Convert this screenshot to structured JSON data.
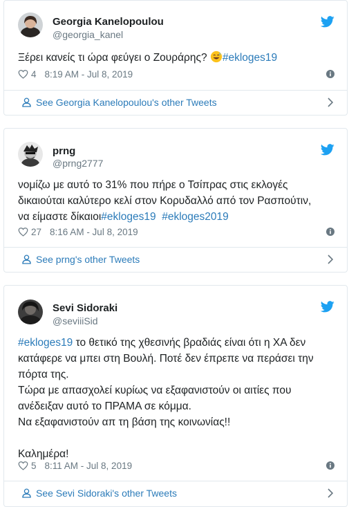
{
  "tweets": [
    {
      "name": "Georgia Kanelopoulou",
      "handle": "@georgia_kanel",
      "text_before": "Ξέρει κανείς τι ώρα φεύγει ο Ζουράρης? ",
      "emoji": "grinning-sweat-emoji",
      "text_hashtag": "#ekloges19",
      "likes": "4",
      "timestamp": "8:19 AM - Jul 8, 2019",
      "other_link": "See Georgia Kanelopoulou's other Tweets"
    },
    {
      "name": "prng",
      "handle": "@prng2777",
      "line1": "νομίζω με αυτό το 31% που πήρε ο Τσίπρας στις εκλογές",
      "line2": "δικαιούται καλύτερο κελί στον Κορυδαλλό από τον Ρασπούτιν,",
      "line3_text": "να είμαστε δίκαιοι",
      "hashtag1": "#ekloges19",
      "hashtag2": "#ekloges2019",
      "likes": "27",
      "timestamp": "8:16 AM - Jul 8, 2019",
      "other_link": "See prng's other Tweets"
    },
    {
      "name": "Sevi Sidoraki",
      "handle": "@seviiiSid",
      "hashtag": "#ekloges19",
      "line1_rest": " το θετικό της χθεσινής βραδιάς είναι ότι η ΧΑ δεν",
      "line2": "κατάφερε να μπει στη Βουλή. Ποτέ δεν έπρεπε να περάσει την",
      "line3": "πόρτα της.",
      "line4": "Τώρα με απασχολεί κυρίως να εξαφανιστούν οι αιτίες που",
      "line5": "ανέδειξαν αυτό το ΠΡΑΜΑ σε κόμμα.",
      "line6": "Να εξαφανιστούν απ τη βάση της κοινωνίας!!",
      "line7": "Καλημέρα!",
      "likes": "5",
      "timestamp": "8:11 AM - Jul 8, 2019",
      "other_link": "See Sevi Sidoraki's other Tweets"
    }
  ],
  "colors": {
    "link": "#2b7bb9",
    "muted": "#697882",
    "border": "#e1e8ed",
    "twitter": "#1da1f2"
  },
  "icons": [
    "twitter-bird-icon",
    "heart-icon",
    "info-icon",
    "person-icon",
    "chevron-right-icon"
  ]
}
